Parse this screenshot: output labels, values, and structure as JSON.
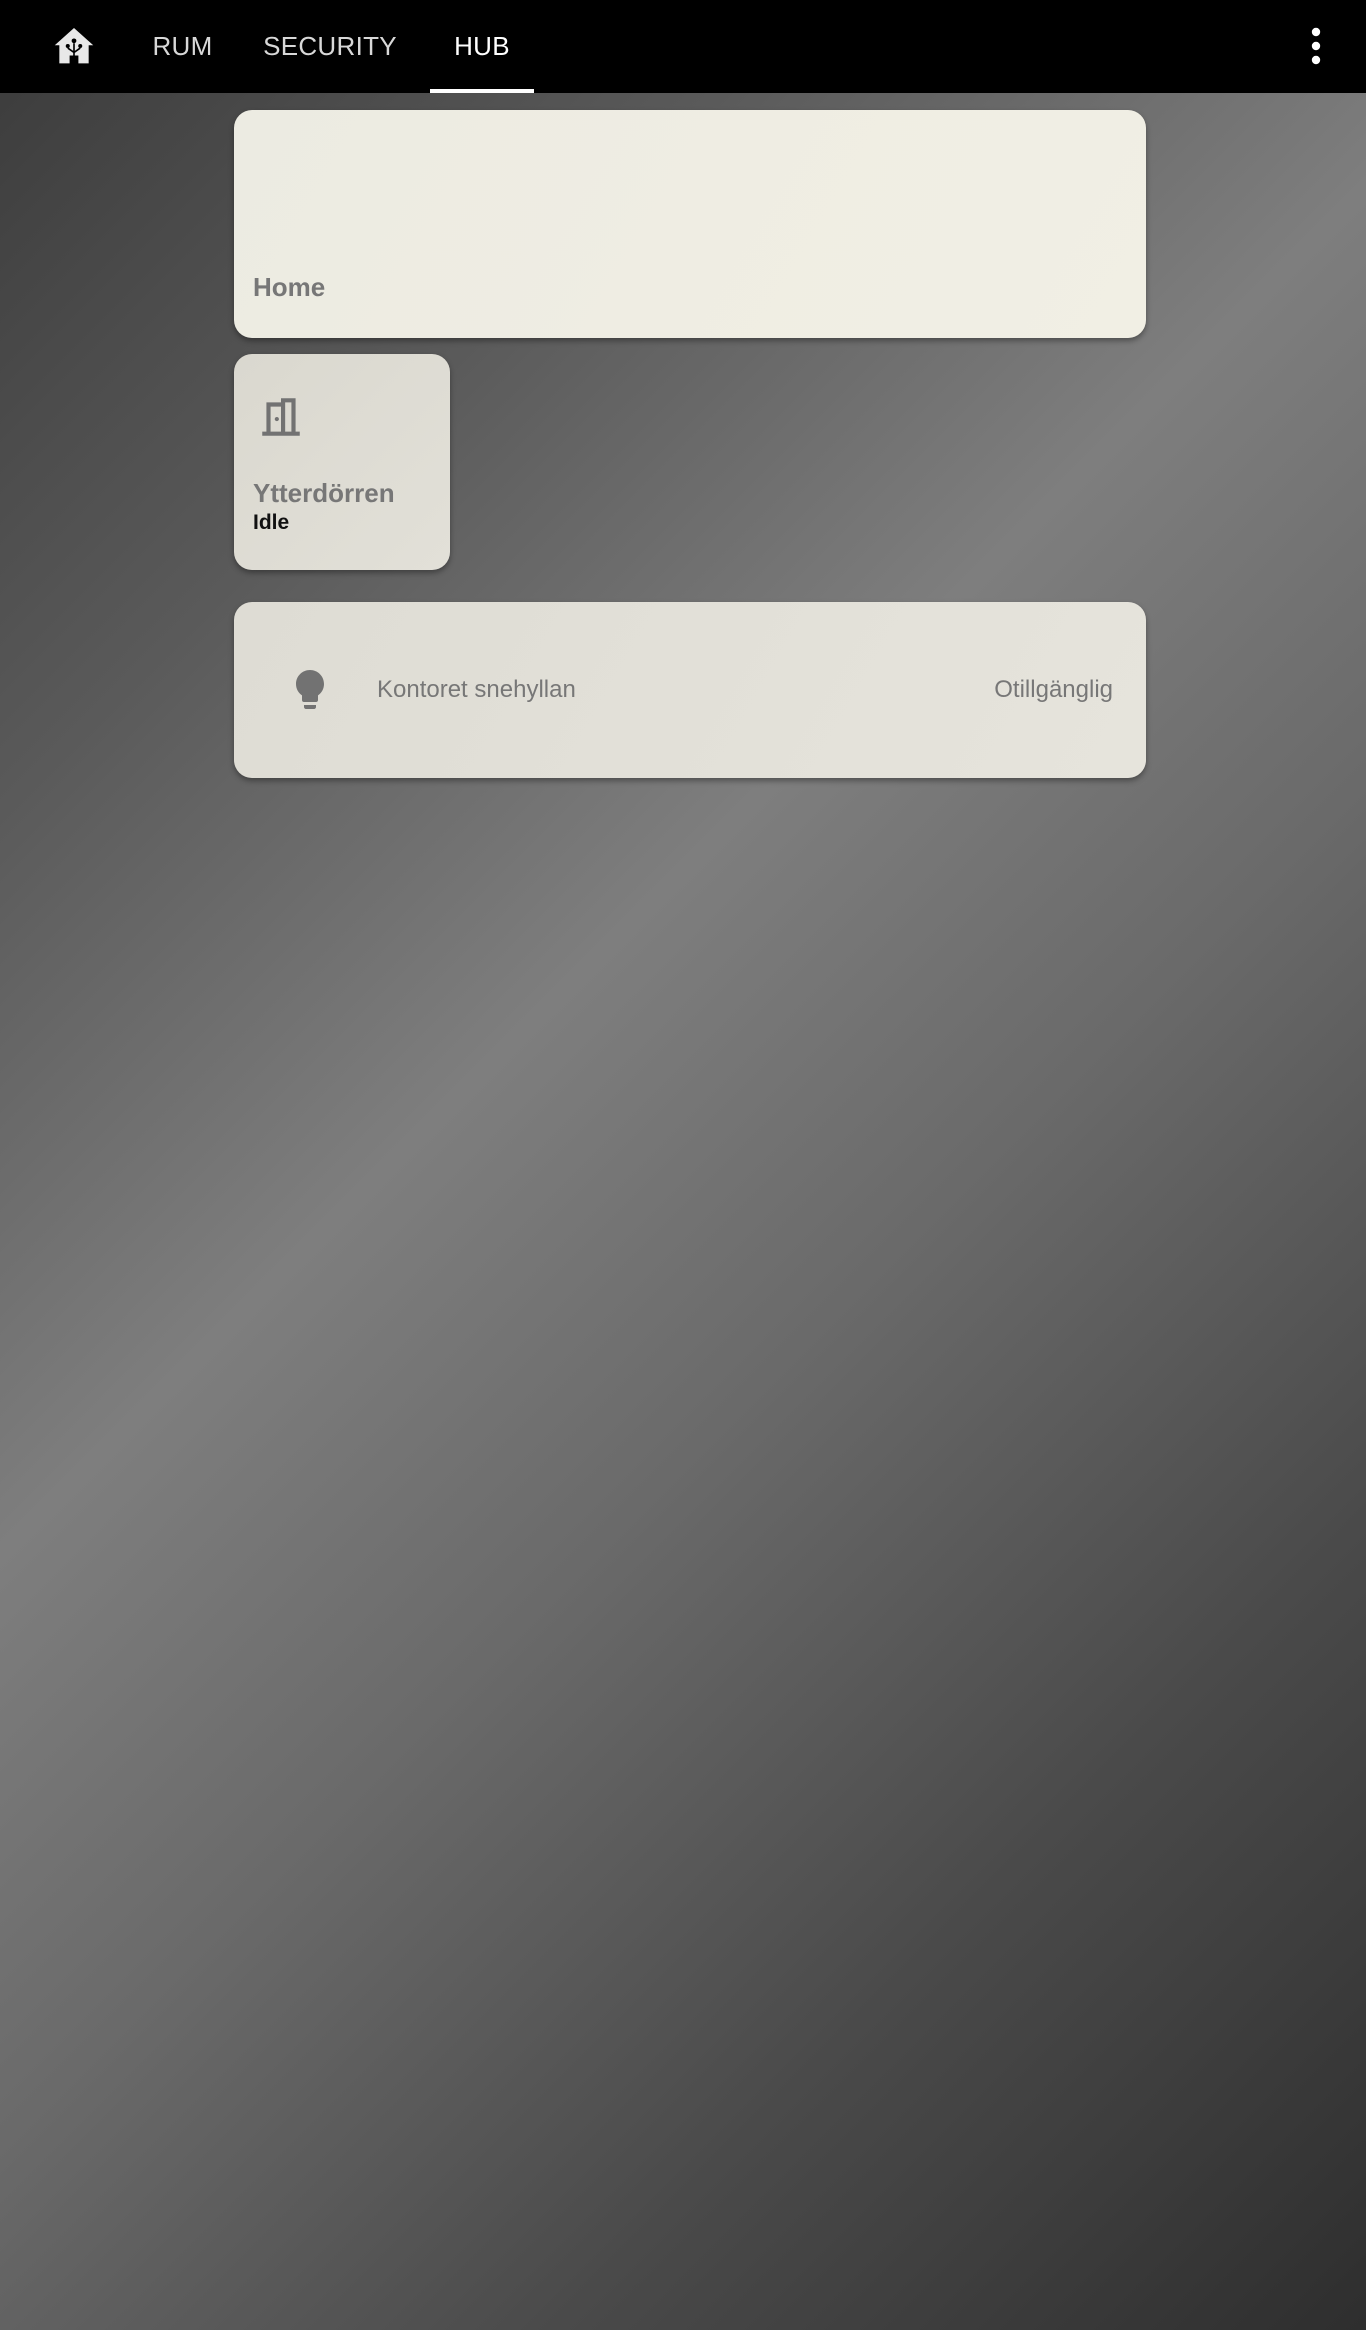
{
  "header": {
    "home_icon": "home-assistant-icon",
    "tabs": [
      {
        "label": "RUM",
        "active": false
      },
      {
        "label": "SECURITY",
        "active": false
      },
      {
        "label": "HUB",
        "active": true
      }
    ],
    "menu_icon": "dots-vertical-icon"
  },
  "main": {
    "picture_card": {
      "title": "Home"
    },
    "door_tile": {
      "icon": "door-icon",
      "name": "Ytterdörren",
      "state": "Idle"
    },
    "entities_card": {
      "rows": [
        {
          "icon": "lightbulb-icon",
          "name": "Kontoret snehyllan",
          "state": "Otillgänglig"
        }
      ]
    }
  },
  "colors": {
    "topbar": "#000000",
    "tab_active": "#ffffff",
    "tab_inactive": "#d8d8d8",
    "card_text": "#777777",
    "icon": "#727272"
  }
}
